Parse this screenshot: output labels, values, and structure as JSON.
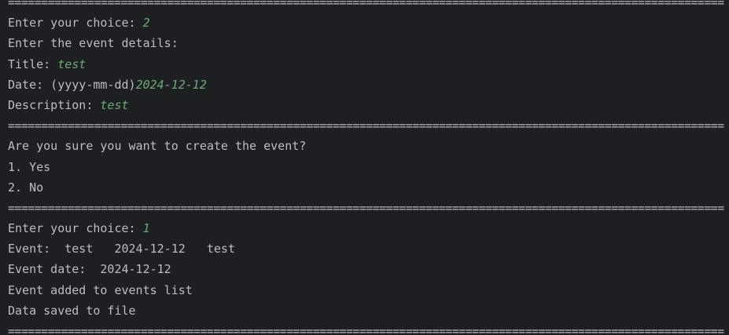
{
  "colors": {
    "background": "#1e1f22",
    "console_text": "#bcbec4",
    "user_input": "#6aab73"
  },
  "console": {
    "separator": "============================================================================================================",
    "lines": [
      {
        "kind": "separator"
      },
      {
        "kind": "prompt",
        "text": "Enter your choice: ",
        "input": "2"
      },
      {
        "kind": "output",
        "text": "Enter the event details:"
      },
      {
        "kind": "prompt",
        "text": "Title: ",
        "input": "test"
      },
      {
        "kind": "prompt",
        "text": "Date: (yyyy-mm-dd)",
        "input": "2024-12-12"
      },
      {
        "kind": "prompt",
        "text": "Description: ",
        "input": "test"
      },
      {
        "kind": "separator"
      },
      {
        "kind": "output",
        "text": "Are you sure you want to create the event?"
      },
      {
        "kind": "output",
        "text": "1. Yes"
      },
      {
        "kind": "output",
        "text": "2. No"
      },
      {
        "kind": "separator"
      },
      {
        "kind": "prompt",
        "text": "Enter your choice: ",
        "input": "1"
      },
      {
        "kind": "output",
        "text": "Event:  test   2024-12-12   test"
      },
      {
        "kind": "output",
        "text": "Event date:  2024-12-12"
      },
      {
        "kind": "output",
        "text": "Event added to events list"
      },
      {
        "kind": "output",
        "text": "Data saved to file"
      },
      {
        "kind": "separator"
      }
    ]
  }
}
